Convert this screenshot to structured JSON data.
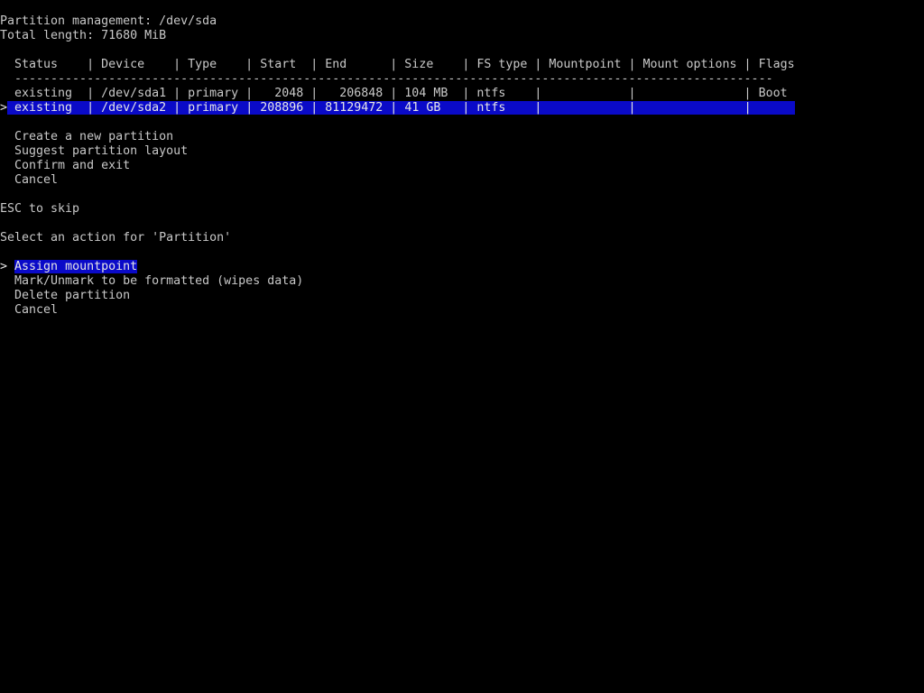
{
  "header": {
    "title": "Partition management: /dev/sda",
    "total_length": "Total length: 71680 MiB"
  },
  "table": {
    "header_row": "  Status    | Device    | Type    | Start  | End      | Size    | FS type | Mountpoint | Mount options | Flags",
    "separator": "  ---------------------------------------------------------------------------------------------------------",
    "rows": [
      {
        "text": "  existing  | /dev/sda1 | primary |   2048 |   206848 | 104 MB  | ntfs    |            |               | Boot",
        "status": "existing",
        "device": "/dev/sda1",
        "type": "primary",
        "start": "2048",
        "end": "206848",
        "size": "104 MB",
        "fs_type": "ntfs",
        "mountpoint": "",
        "mount_options": "",
        "flags": "Boot",
        "selected": false
      },
      {
        "cursor": ">",
        "text": " existing  | /dev/sda2 | primary | 208896 | 81129472 | 41 GB   | ntfs    |            |               |      ",
        "status": "existing",
        "device": "/dev/sda2",
        "type": "primary",
        "start": "208896",
        "end": "81129472",
        "size": "41 GB",
        "fs_type": "ntfs",
        "mountpoint": "",
        "mount_options": "",
        "flags": "",
        "selected": true
      }
    ]
  },
  "partition_menu": [
    "  Create a new partition",
    "  Suggest partition layout",
    "  Confirm and exit",
    "  Cancel"
  ],
  "hint": "ESC to skip",
  "prompt": "Select an action for 'Partition'",
  "action_menu": {
    "cursor": ">",
    "selected": "Assign mountpoint",
    "items": [
      "  Mark/Unmark to be formatted (wipes data)",
      "  Delete partition",
      "  Cancel"
    ]
  },
  "colors": {
    "background": "#000000",
    "text": "#c8c8c8",
    "highlight": "#0a0ac8"
  }
}
